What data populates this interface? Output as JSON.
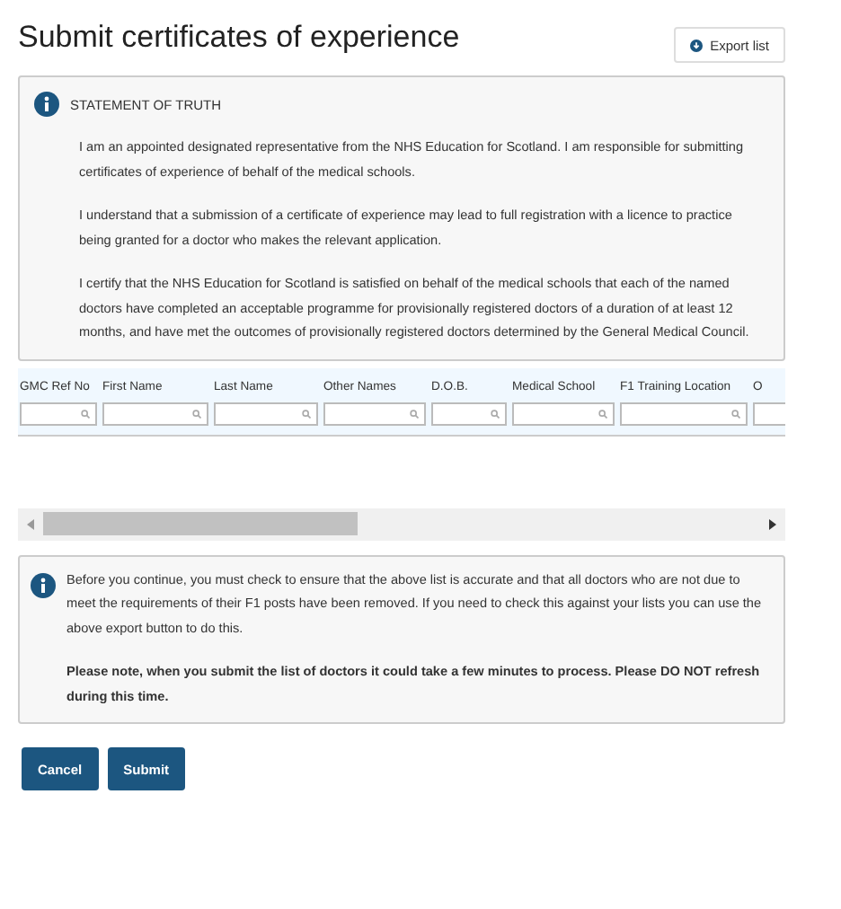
{
  "page": {
    "title": "Submit certificates of experience",
    "export_button": "Export list"
  },
  "statement": {
    "heading": "STATEMENT OF TRUTH",
    "paragraphs": [
      "I am an appointed designated representative from the NHS Education for Scotland. I am responsible for submitting certificates of experience of behalf of the medical schools.",
      "I understand that a submission of a certificate of experience may lead to full registration with a licence to practice being granted for a doctor who makes the relevant application.",
      "I certify that the NHS Education for Scotland is satisfied on behalf of the medical schools that each of the named doctors have completed an acceptable programme for provisionally registered doctors of a duration of at least 12 months, and have met the outcomes of provisionally registered doctors determined by the General Medical Council."
    ]
  },
  "table": {
    "columns": [
      {
        "label": "GMC Ref No"
      },
      {
        "label": "First Name"
      },
      {
        "label": "Last Name"
      },
      {
        "label": "Other Names"
      },
      {
        "label": "D.O.B."
      },
      {
        "label": "Medical School"
      },
      {
        "label": "F1 Training Location"
      },
      {
        "label": "O"
      }
    ]
  },
  "notice": {
    "paragraphs": [
      {
        "text": "Before you continue, you must check to ensure that the above list is accurate and that all doctors who are not due to meet the requirements of their F1 posts have been removed. If you need to check this against your lists you can use the above export button to do this.",
        "bold": false
      },
      {
        "text": "Please note, when you submit the list of doctors it could take a few minutes to process. Please DO NOT refresh during this time.",
        "bold": true
      }
    ]
  },
  "buttons": [
    {
      "label": "Cancel"
    },
    {
      "label": "Submit"
    }
  ]
}
